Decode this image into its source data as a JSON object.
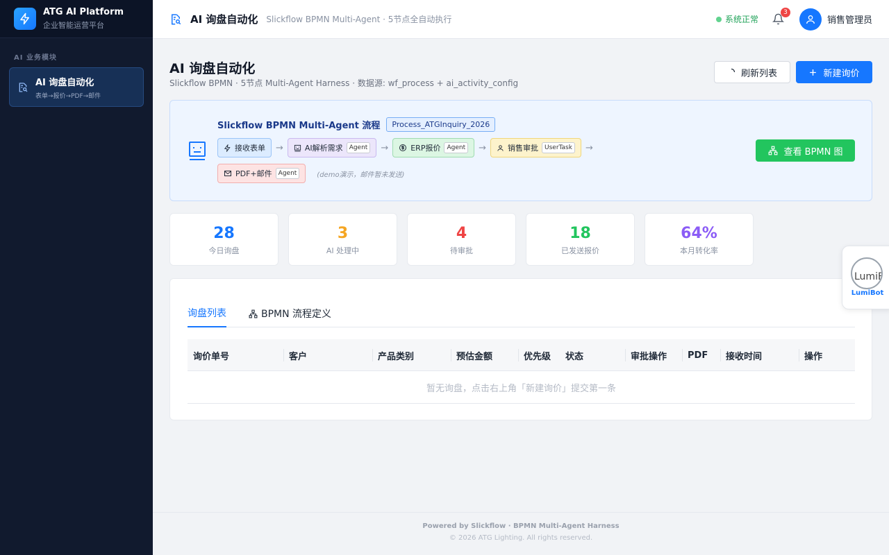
{
  "brand": {
    "title": "ATG AI Platform",
    "subtitle": "企业智能运营平台"
  },
  "sidebar": {
    "section_label": "AI 业务模块",
    "items": [
      {
        "label": "AI 询盘自动化",
        "sub": "表单→报价→PDF→邮件"
      }
    ]
  },
  "header": {
    "title": "AI 询盘自动化",
    "subtitle": "Slickflow BPMN Multi-Agent · 5节点全自动执行",
    "status": "系统正常",
    "notification_count": "3",
    "user": "销售管理员"
  },
  "page": {
    "title": "AI 询盘自动化",
    "subtitle": "Slickflow BPMN · 5节点 Multi-Agent Harness · 数据源: wf_process + ai_activity_config",
    "refresh_label": "刷新列表",
    "new_label": "新建询价"
  },
  "bpmn": {
    "title": "Slickflow BPMN Multi-Agent 流程",
    "process_id": "Process_ATGInquiry_2026",
    "steps": [
      {
        "label": "接收表单",
        "tag": ""
      },
      {
        "label": "AI解析需求",
        "tag": "Agent"
      },
      {
        "label": "ERP报价",
        "tag": "Agent"
      },
      {
        "label": "销售审批",
        "tag": "UserTask"
      },
      {
        "label": "PDF+邮件",
        "tag": "Agent"
      }
    ],
    "arrow": "→",
    "note": "(demo演示，邮件暂未发送)",
    "view_button": "查看 BPMN 图"
  },
  "stats": [
    {
      "value": "28",
      "label": "今日询盘",
      "color": "#1677ff"
    },
    {
      "value": "3",
      "label": "AI 处理中",
      "color": "#f5a623"
    },
    {
      "value": "4",
      "label": "待审批",
      "color": "#ef4444"
    },
    {
      "value": "18",
      "label": "已发送报价",
      "color": "#22c55e"
    },
    {
      "value": "64%",
      "label": "本月转化率",
      "color": "#8b5cf6"
    }
  ],
  "table": {
    "tabs": [
      {
        "label": "询盘列表"
      },
      {
        "label": "BPMN 流程定义"
      }
    ],
    "columns": [
      "询价单号",
      "客户",
      "产品类别",
      "预估金额",
      "优先级",
      "状态",
      "审批操作",
      "PDF",
      "接收时间",
      "操作"
    ],
    "empty_text": "暂无询盘，点击右上角「新建询价」提交第一条"
  },
  "lumibot": {
    "image_text": "LumiB",
    "label": "LumiBot"
  },
  "footer": {
    "line1": "Powered by Slickflow · BPMN Multi-Agent Harness",
    "line2": "© 2026 ATG Lighting. All rights reserved."
  }
}
